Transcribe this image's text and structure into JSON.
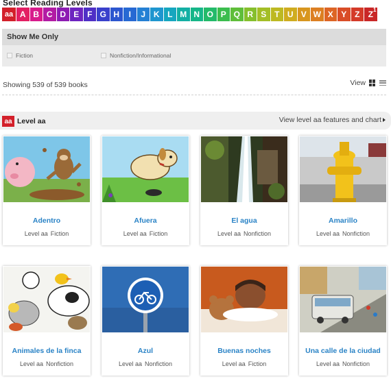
{
  "page": {
    "select_title": "Select Reading Levels",
    "levels": [
      {
        "label": "aa",
        "color": "#d3202a"
      },
      {
        "label": "A",
        "color": "#e31f63"
      },
      {
        "label": "B",
        "color": "#d81b8c"
      },
      {
        "label": "C",
        "color": "#b21ba4"
      },
      {
        "label": "D",
        "color": "#8d1cb3"
      },
      {
        "label": "E",
        "color": "#6d24c0"
      },
      {
        "label": "F",
        "color": "#4f2fc6"
      },
      {
        "label": "G",
        "color": "#3a40cc"
      },
      {
        "label": "H",
        "color": "#2c56cf"
      },
      {
        "label": "I",
        "color": "#2769d3"
      },
      {
        "label": "J",
        "color": "#2580d4"
      },
      {
        "label": "K",
        "color": "#1f96cf"
      },
      {
        "label": "L",
        "color": "#16a6bf"
      },
      {
        "label": "M",
        "color": "#13afa4"
      },
      {
        "label": "N",
        "color": "#16b688"
      },
      {
        "label": "O",
        "color": "#23ba6a"
      },
      {
        "label": "P",
        "color": "#3bbd4e"
      },
      {
        "label": "Q",
        "color": "#5fbe3a"
      },
      {
        "label": "R",
        "color": "#86bf2d"
      },
      {
        "label": "S",
        "color": "#a4be26"
      },
      {
        "label": "T",
        "color": "#bdb922"
      },
      {
        "label": "U",
        "color": "#cfac1f"
      },
      {
        "label": "V",
        "color": "#d8961f"
      },
      {
        "label": "W",
        "color": "#dc7f22"
      },
      {
        "label": "X",
        "color": "#dd6525"
      },
      {
        "label": "Y",
        "color": "#d94d27"
      },
      {
        "label": "Z",
        "color": "#d43a28"
      },
      {
        "label": "Z",
        "color": "#c92727",
        "sup": "1"
      }
    ],
    "filter": {
      "header": "Show Me Only",
      "options": [
        "Fiction",
        "Nonfiction/Informational"
      ]
    },
    "showing_text": "Showing 539 of 539 books",
    "view_label": "View",
    "level_section": {
      "badge": "aa",
      "title": "Level aa",
      "link": "View level aa features and chart"
    },
    "books": [
      {
        "title": "Adentro",
        "level": "Level aa",
        "genre": "Fiction",
        "art": "pig-monkey"
      },
      {
        "title": "Afuera",
        "level": "Level aa",
        "genre": "Fiction",
        "art": "dog"
      },
      {
        "title": "El agua",
        "level": "Level aa",
        "genre": "Nonfiction",
        "art": "waterfall"
      },
      {
        "title": "Amarillo",
        "level": "Level aa",
        "genre": "Nonfiction",
        "art": "hydrant"
      },
      {
        "title": "Animales de la finca",
        "level": "Level aa",
        "genre": "Nonfiction",
        "art": "farm-animals"
      },
      {
        "title": "Azul",
        "level": "Level aa",
        "genre": "Nonfiction",
        "art": "bike-sign"
      },
      {
        "title": "Buenas noches",
        "level": "Level aa",
        "genre": "Fiction",
        "art": "sleeping-child"
      },
      {
        "title": "Una calle de la ciudad",
        "level": "Level aa",
        "genre": "Nonfiction",
        "art": "city-street"
      }
    ]
  }
}
